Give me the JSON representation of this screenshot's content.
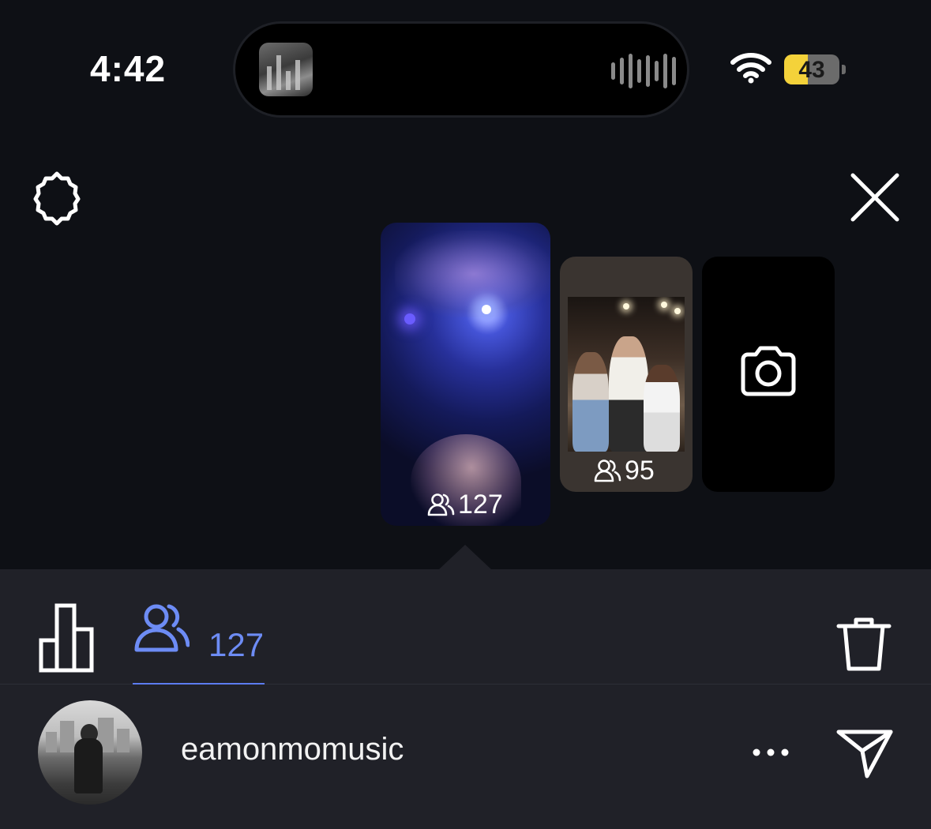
{
  "status_bar": {
    "time": "4:42",
    "battery_level": "43",
    "battery_fraction": 0.43,
    "battery_color": "#f4d23a"
  },
  "icons": {
    "settings": "gear-icon",
    "close": "close-icon",
    "camera": "camera-icon",
    "viewers": "viewers-icon",
    "insights": "bar-chart-icon",
    "delete": "trash-icon",
    "more": "more-icon",
    "send": "send-icon"
  },
  "stories": [
    {
      "viewers": "127",
      "selected": true
    },
    {
      "viewers": "95",
      "selected": false
    }
  ],
  "tabs": {
    "viewers_count": "127",
    "accent_color": "#5c7cf0"
  },
  "viewer_list": [
    {
      "username": "eamonmomusic"
    }
  ]
}
